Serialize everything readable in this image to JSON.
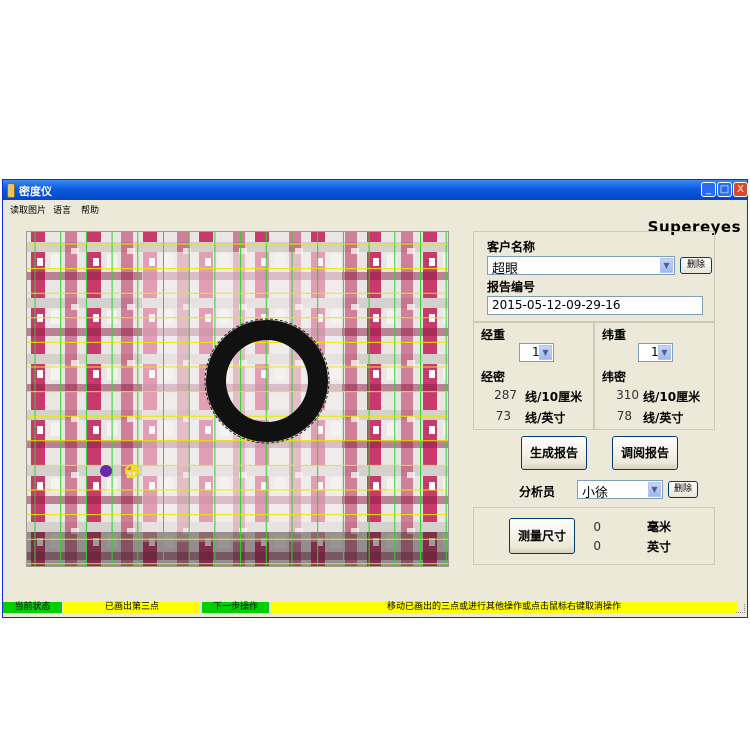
{
  "window": {
    "title": "密度仪",
    "buttons": [
      "_",
      "□",
      "X"
    ]
  },
  "menu": [
    "读取图片",
    "语言",
    "帮助"
  ],
  "logo": "Supereyes",
  "customer": {
    "name_label": "客户名称",
    "name_value": "超眼",
    "delete_label": "删除",
    "report_label": "报告编号",
    "report_value": "2015-05-12-09-29-16"
  },
  "warp": {
    "weight_label": "经重",
    "weight_value": "1",
    "density_label": "经密",
    "count_per_10cm": "287",
    "unit_10cm": "线/10厘米",
    "count_per_inch": "73",
    "unit_inch": "线/英寸"
  },
  "weft": {
    "weight_label": "纬重",
    "weight_value": "1",
    "density_label": "纬密",
    "count_per_10cm": "310",
    "unit_10cm": "线/10厘米",
    "count_per_inch": "78",
    "unit_inch": "线/英寸"
  },
  "actions": {
    "generate_label": "生成报告",
    "view_label": "调阅报告",
    "analyst_label": "分析员",
    "analyst_value": "小徐",
    "delete_label": "删除"
  },
  "measure": {
    "button_label": "测量尺寸",
    "mm_value": "0",
    "mm_unit": "毫米",
    "inch_value": "0",
    "inch_unit": "英寸"
  },
  "status": {
    "state_label": "当前状态",
    "state_value": "已画出第三点",
    "next_label": "下一步操作",
    "next_value": "移动已画出的三点或进行其他操作或点击鼠标右键取消操作"
  },
  "colors": {
    "titlebar": "#0a5ae0",
    "status_yellow": "#ffff00",
    "status_green": "#00d000",
    "grid_green": "#2fd12f",
    "grid_yellow": "#e8e800"
  },
  "icons": {
    "measure_marker": "crosshair-circle-icon"
  }
}
